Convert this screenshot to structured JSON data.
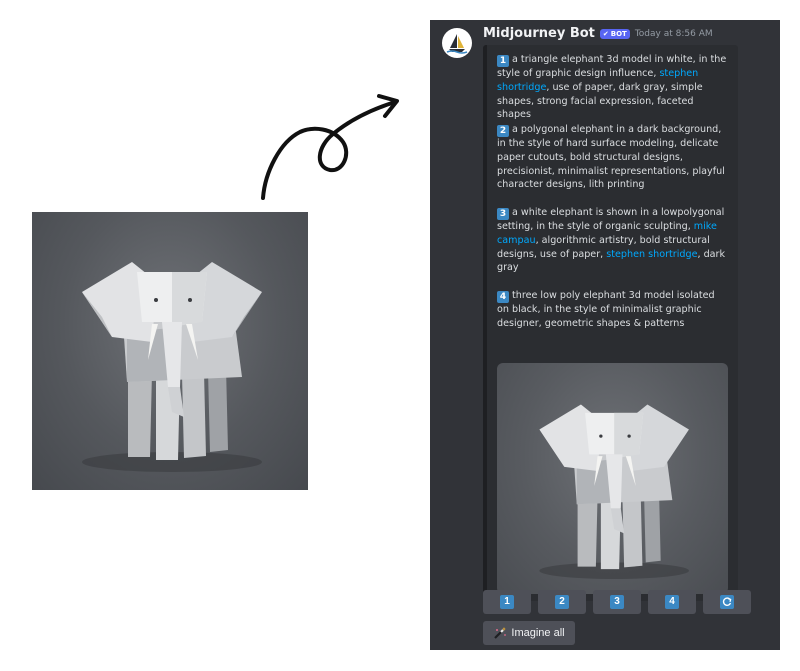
{
  "message": {
    "author": "Midjourney Bot",
    "badge": "BOT",
    "timestamp": "Today at 8:56 AM"
  },
  "prompts": [
    {
      "num": "1",
      "parts": [
        {
          "text": "a triangle elephant 3d model in white, in the style of graphic design influence, "
        },
        {
          "text": "stephen shortridge",
          "link": true
        },
        {
          "text": ", use of paper, dark gray, simple shapes, strong facial expression, faceted shapes"
        }
      ]
    },
    {
      "num": "2",
      "parts": [
        {
          "text": "a polygonal elephant in a dark background, in the style of hard surface modeling, delicate paper cutouts, bold structural designs, precisionist, minimalist representations, playful character designs, lith printing"
        }
      ]
    },
    {
      "num": "3",
      "parts": [
        {
          "text": "a white elephant is shown in a lowpolygonal setting, in the style of organic sculpting, "
        },
        {
          "text": "mike campau",
          "link": true
        },
        {
          "text": ", algorithmic artistry, bold structural designs, use of paper, "
        },
        {
          "text": "stephen shortridge",
          "link": true
        },
        {
          "text": ", dark gray"
        }
      ]
    },
    {
      "num": "4",
      "parts": [
        {
          "text": "three low poly elephant 3d model isolated on black, in the style of minimalist graphic designer, geometric shapes & patterns"
        }
      ]
    }
  ],
  "buttons": {
    "u1": "1",
    "u2": "2",
    "u3": "3",
    "u4": "4",
    "reroll_icon": "refresh-icon",
    "imagine_all": "Imagine all"
  },
  "colors": {
    "discord_bg": "#313338",
    "embed_bg": "#2b2d31",
    "link": "#00a8fc",
    "badge": "#5865f2",
    "keycap": "#3b88c3",
    "button": "#4e5058"
  }
}
